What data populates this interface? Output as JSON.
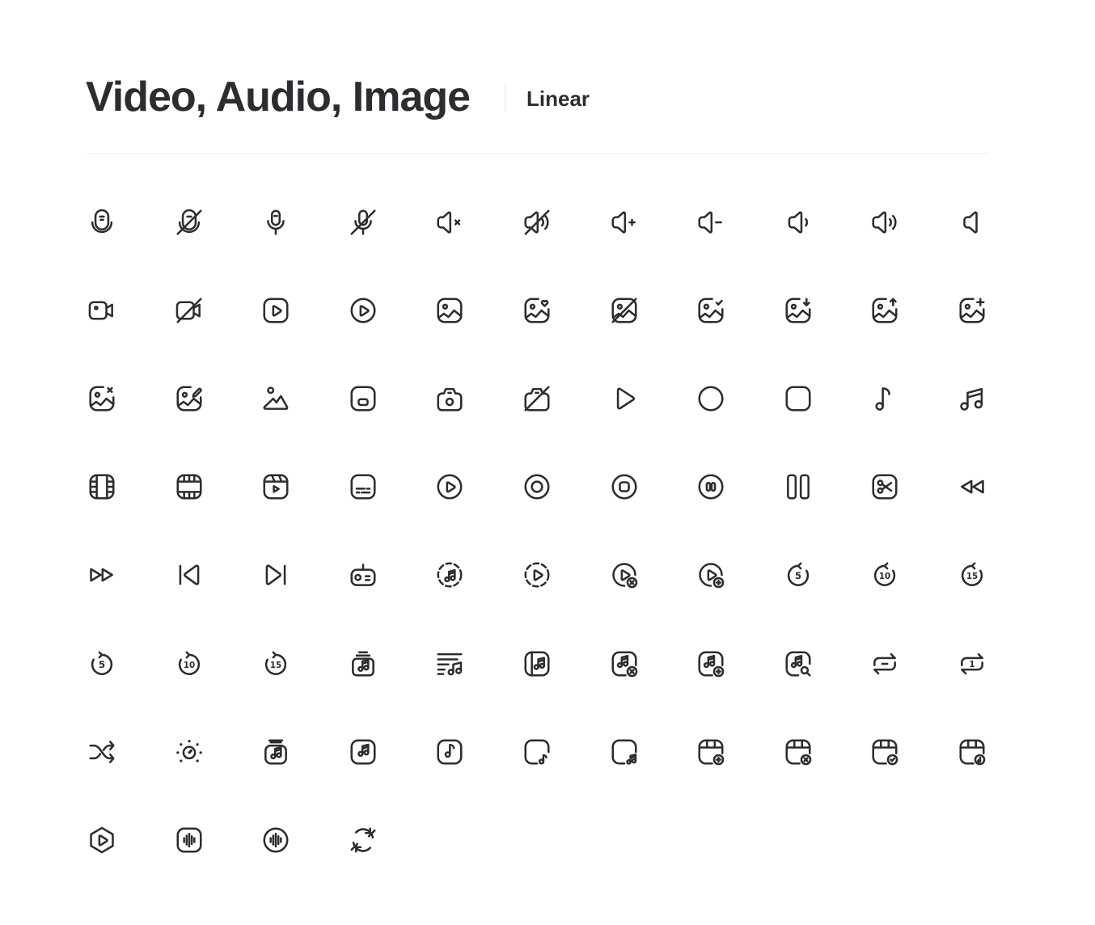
{
  "header": {
    "title": "Video, Audio, Image",
    "style_label": "Linear"
  },
  "icon_color": "#2b2d31",
  "icons": [
    "mic-podcast-icon",
    "mic-podcast-off-icon",
    "microphone-icon",
    "microphone-off-icon",
    "volume-mute-icon",
    "volume-off-icon",
    "volume-plus-icon",
    "volume-minus-icon",
    "volume-low-icon",
    "volume-high-icon",
    "volume-none-icon",
    "video-camera-icon",
    "video-camera-off-icon",
    "play-square-icon",
    "play-circle-icon",
    "gallery-icon",
    "gallery-favourite-icon",
    "gallery-off-icon",
    "gallery-check-icon",
    "gallery-download-icon",
    "gallery-upload-icon",
    "gallery-add-icon",
    "gallery-remove-icon",
    "gallery-edit-icon",
    "landscape-icon",
    "picture-in-picture-icon",
    "camera-icon",
    "camera-off-icon",
    "play-icon",
    "record-icon",
    "stop-icon",
    "music-note-icon",
    "music-notes-icon",
    "film-strip-icon",
    "film-strip-wide-icon",
    "video-library-icon",
    "subtitles-icon",
    "play-circle-2-icon",
    "record-circle-icon",
    "stop-circle-icon",
    "pause-circle-icon",
    "pause-icon",
    "scissors-square-icon",
    "rewind-icon",
    "fast-forward-icon",
    "skip-previous-icon",
    "skip-next-icon",
    "radio-icon",
    "music-circle-dashed-icon",
    "play-circle-dashed-icon",
    "play-remove-icon",
    "play-add-icon",
    "rewind-5-icon",
    "rewind-10-icon",
    "rewind-15-icon",
    "forward-5-icon",
    "forward-10-icon",
    "forward-15-icon",
    "music-library-icon",
    "music-playlist-icon",
    "music-album-icon",
    "music-square-remove-icon",
    "music-square-add-icon",
    "music-square-search-icon",
    "repeat-icon",
    "repeat-one-icon",
    "shuffle-icon",
    "brightness-icon",
    "music-stack-icon",
    "music-square-icon",
    "music-note-square-icon",
    "note-corner-icon",
    "notes-corner-icon",
    "calendar-add-icon",
    "calendar-remove-icon",
    "calendar-check-icon",
    "calendar-music-icon",
    "play-hexagon-icon",
    "sound-wave-square-icon",
    "sound-wave-circle-icon",
    "refresh-arrows-icon"
  ]
}
